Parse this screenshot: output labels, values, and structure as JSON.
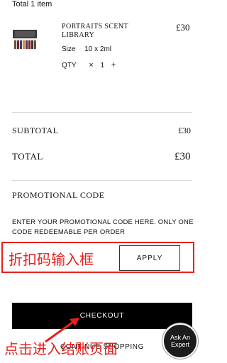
{
  "header": {
    "title": "Total 1 item"
  },
  "item": {
    "name": "PORTRAITS SCENT LIBRARY",
    "price": "£30",
    "size_label": "Size",
    "size_value": "10 x 2ml",
    "qty_label": "QTY",
    "qty_minus": "×",
    "qty_value": "1",
    "qty_plus": "+"
  },
  "summary": {
    "subtotal_label": "SUBTOTAL",
    "subtotal_value": "£30",
    "total_label": "TOTAL",
    "total_value": "£30"
  },
  "promo": {
    "title": "PROMOTIONAL CODE",
    "description": "ENTER YOUR PROMOTIONAL CODE HERE. ONLY ONE CODE REDEEMABLE PER ORDER",
    "annotation": "折扣码输入框",
    "apply_label": "APPLY"
  },
  "actions": {
    "checkout_label": "CHECKOUT",
    "continue_label": "CONTINUE SHOPPING",
    "checkout_annotation": "点击进入结账页面"
  },
  "expert": {
    "label": "Ask An Expert"
  },
  "colors": {
    "annotation": "#e8201c",
    "button": "#000000"
  }
}
